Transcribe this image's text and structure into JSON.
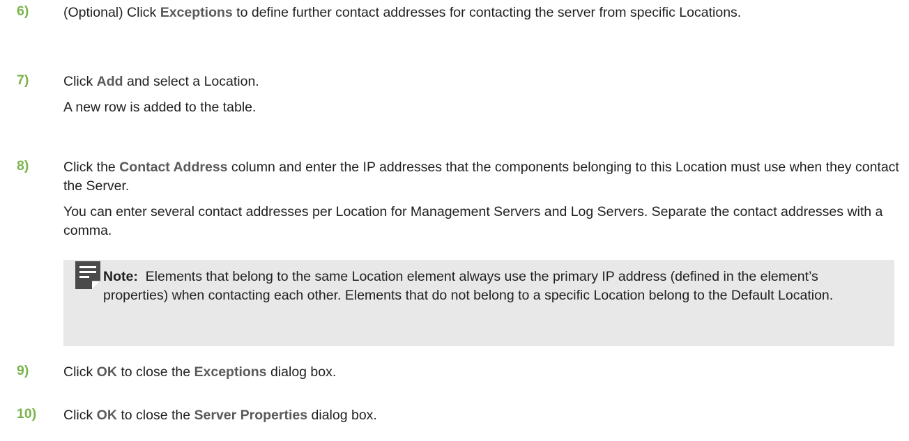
{
  "steps": [
    {
      "num": "6)",
      "a": "(Optional) Click ",
      "b": "Exceptions",
      "c": " to define further contact addresses for contacting the server from specific Locations."
    },
    {
      "num": "7)",
      "a": "Click ",
      "b": "Add",
      "c": " and select a Location.",
      "sub": "A new row is added to the table."
    },
    {
      "num": "8)",
      "a": "Click the ",
      "b": "Contact Address",
      "c": " column and enter the IP addresses that the components belonging to this Location must use when they contact the Server.",
      "sub": "You can enter several contact addresses per Location for Management Servers and Log Servers. Separate the contact addresses with a comma."
    },
    {
      "num": "9)",
      "a": "Click ",
      "b": "OK",
      "c": " to close the ",
      "d": "Exceptions",
      "e": " dialog box."
    },
    {
      "num": "10)",
      "a": "Click ",
      "b": "OK",
      "c": " to close the ",
      "d": "Server Properties",
      "e": " dialog box."
    }
  ],
  "note": {
    "icon": "note-icon",
    "label": "Note:",
    "text": "Elements that belong to the same Location element always use the primary IP address (defined in the element’s properties) when contacting each other. Elements that do not belong to a specific Location belong to the Default Location."
  },
  "colors": {
    "step_number": "#7ab34a",
    "ui_term": "#5a5a5a",
    "note_background": "#e8e8e8",
    "note_icon": "#4a4a4a"
  }
}
